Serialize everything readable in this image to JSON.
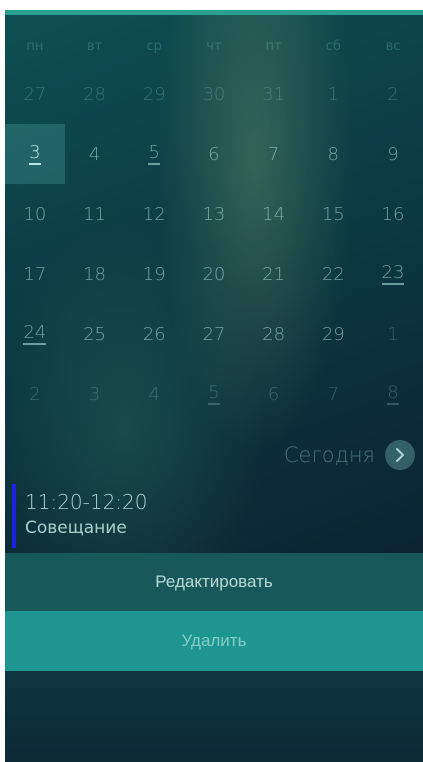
{
  "calendar": {
    "weekdays": [
      "пн",
      "вт",
      "ср",
      "чт",
      "пт",
      "сб",
      "вс"
    ],
    "weeks": [
      [
        "27",
        "28",
        "29",
        "30",
        "31",
        "1",
        "2"
      ],
      [
        "3",
        "4",
        "5",
        "6",
        "7",
        "8",
        "9"
      ],
      [
        "10",
        "11",
        "12",
        "13",
        "14",
        "15",
        "16"
      ],
      [
        "17",
        "18",
        "19",
        "20",
        "21",
        "22",
        "23"
      ],
      [
        "24",
        "25",
        "26",
        "27",
        "28",
        "29",
        "1"
      ],
      [
        "2",
        "3",
        "4",
        "5",
        "6",
        "7",
        "8"
      ]
    ],
    "selected_day": "3",
    "today_label": "Сегодня"
  },
  "event": {
    "time": "11:20-12:20",
    "title": "Совещание",
    "color": "#1a24e0"
  },
  "actions": {
    "edit_label": "Редактировать",
    "delete_label": "Удалить"
  },
  "icons": {
    "today_button": "chevron-right-icon"
  }
}
